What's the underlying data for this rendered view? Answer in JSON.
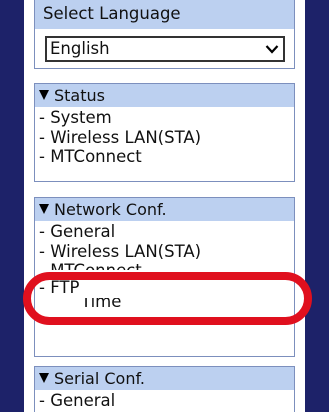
{
  "language": {
    "title": "Select Language",
    "selected": "English",
    "dropdown_icon": "chevron-down-icon"
  },
  "sections": {
    "status": {
      "header": "Status",
      "items": [
        "- System",
        "- Wireless LAN(STA)",
        "- MTConnect"
      ]
    },
    "network": {
      "header": "Network Conf.",
      "items": [
        "- General",
        "- Wireless LAN(STA)",
        "- MTConnect",
        "- FTP",
        "Time"
      ]
    },
    "serial": {
      "header": "Serial Conf.",
      "items": [
        "- General"
      ]
    }
  },
  "colors": {
    "navy": "#1d2269",
    "header_bg": "#bcd0f0",
    "highlight": "#e0101e"
  }
}
